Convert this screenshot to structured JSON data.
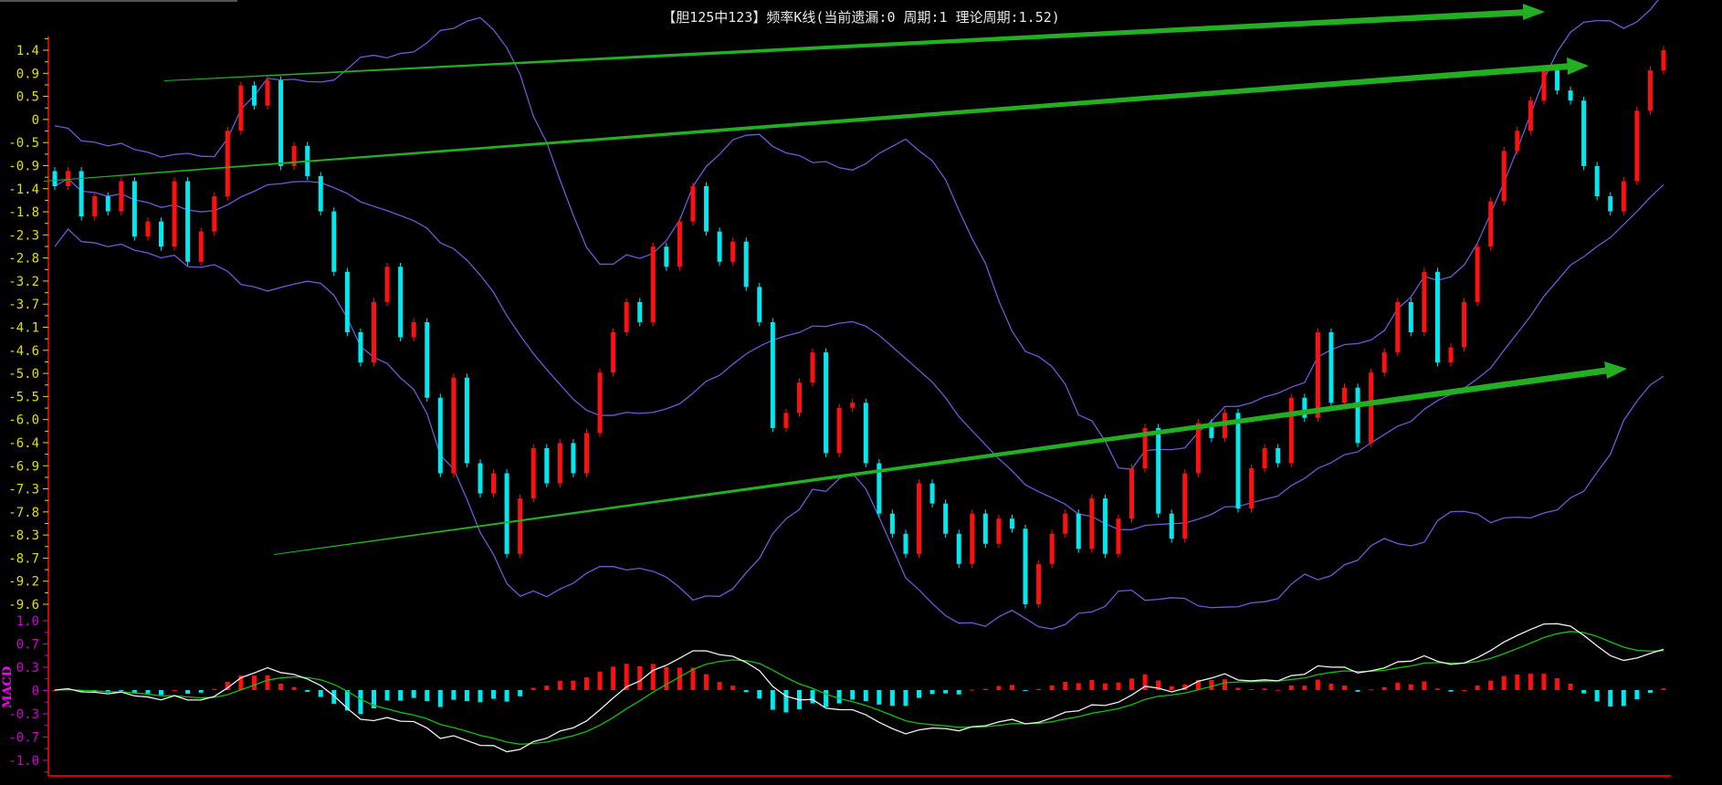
{
  "title": "【胆125中123】频率K线(当前遗漏:0 周期:1 理论周期:1.52)",
  "colors": {
    "up": "#ff1010",
    "down": "#00e8f0",
    "band": "#6a5ad8",
    "dif": "#f0f0f0",
    "dea": "#10c010",
    "axis": "#d00000",
    "arrow": "#22b022",
    "price_label": "#e0e000",
    "macd_label": "#d000d0"
  },
  "chart_data": [
    {
      "type": "candlestick",
      "title": "频率K线",
      "ylim": [
        -9.6,
        1.4
      ],
      "y_ticks": [
        "1.4",
        "0.9",
        "0.5",
        "0",
        "-0.5",
        "-0.9",
        "-1.4",
        "-1.8",
        "-2.3",
        "-2.8",
        "-3.2",
        "-3.7",
        "-4.1",
        "-4.6",
        "-5.0",
        "-5.5",
        "-6.0",
        "-6.4",
        "-6.9",
        "-7.3",
        "-7.8",
        "-8.3",
        "-8.7",
        "-9.2",
        "-9.6"
      ],
      "overlay": "Bollinger bands (20, 2)",
      "closes": [
        -1.3,
        -1.0,
        -1.9,
        -1.5,
        -1.8,
        -1.2,
        -2.3,
        -2.0,
        -2.5,
        -1.2,
        -2.8,
        -2.2,
        -1.5,
        -0.2,
        0.7,
        0.3,
        0.8,
        -0.9,
        -0.5,
        -1.1,
        -1.8,
        -3.0,
        -4.2,
        -4.8,
        -3.6,
        -2.9,
        -4.3,
        -4.0,
        -5.5,
        -7.0,
        -5.1,
        -6.8,
        -7.4,
        -7.0,
        -8.6,
        -7.5,
        -6.5,
        -7.2,
        -6.4,
        -7.0,
        -6.2,
        -5.0,
        -4.2,
        -3.6,
        -4.0,
        -2.5,
        -2.9,
        -2.0,
        -1.3,
        -2.2,
        -2.8,
        -2.4,
        -3.3,
        -4.0,
        -6.1,
        -5.8,
        -5.2,
        -4.6,
        -6.6,
        -5.7,
        -5.6,
        -6.8,
        -7.8,
        -8.2,
        -8.6,
        -7.2,
        -7.6,
        -8.2,
        -8.8,
        -7.8,
        -8.4,
        -7.9,
        -8.1,
        -9.6,
        -8.8,
        -8.2,
        -7.8,
        -8.5,
        -7.5,
        -8.6,
        -7.9,
        -6.9,
        -6.1,
        -7.8,
        -8.3,
        -7.0,
        -6.0,
        -6.3,
        -5.8,
        -7.7,
        -6.9,
        -6.5,
        -6.8,
        -5.5,
        -5.9,
        -4.2,
        -5.6,
        -5.3,
        -6.4,
        -5.0,
        -4.6,
        -3.6,
        -4.2,
        -3.0,
        -4.8,
        -4.5,
        -3.6,
        -2.5,
        -1.6,
        -0.6,
        -0.2,
        0.4,
        1.0,
        0.6,
        0.4,
        -0.9,
        -1.5,
        -1.8,
        -1.2,
        0.2,
        1.0,
        1.4
      ],
      "trend_arrows": 3
    },
    {
      "type": "macd",
      "name": "MACD",
      "ylim": [
        -1.0,
        1.0
      ],
      "y_ticks": [
        "1.0",
        "0.7",
        "0.3",
        "0",
        "-0.3",
        "-0.7",
        "-1.0"
      ],
      "series": [
        "DIF",
        "DEA",
        "MACD histogram"
      ]
    }
  ]
}
